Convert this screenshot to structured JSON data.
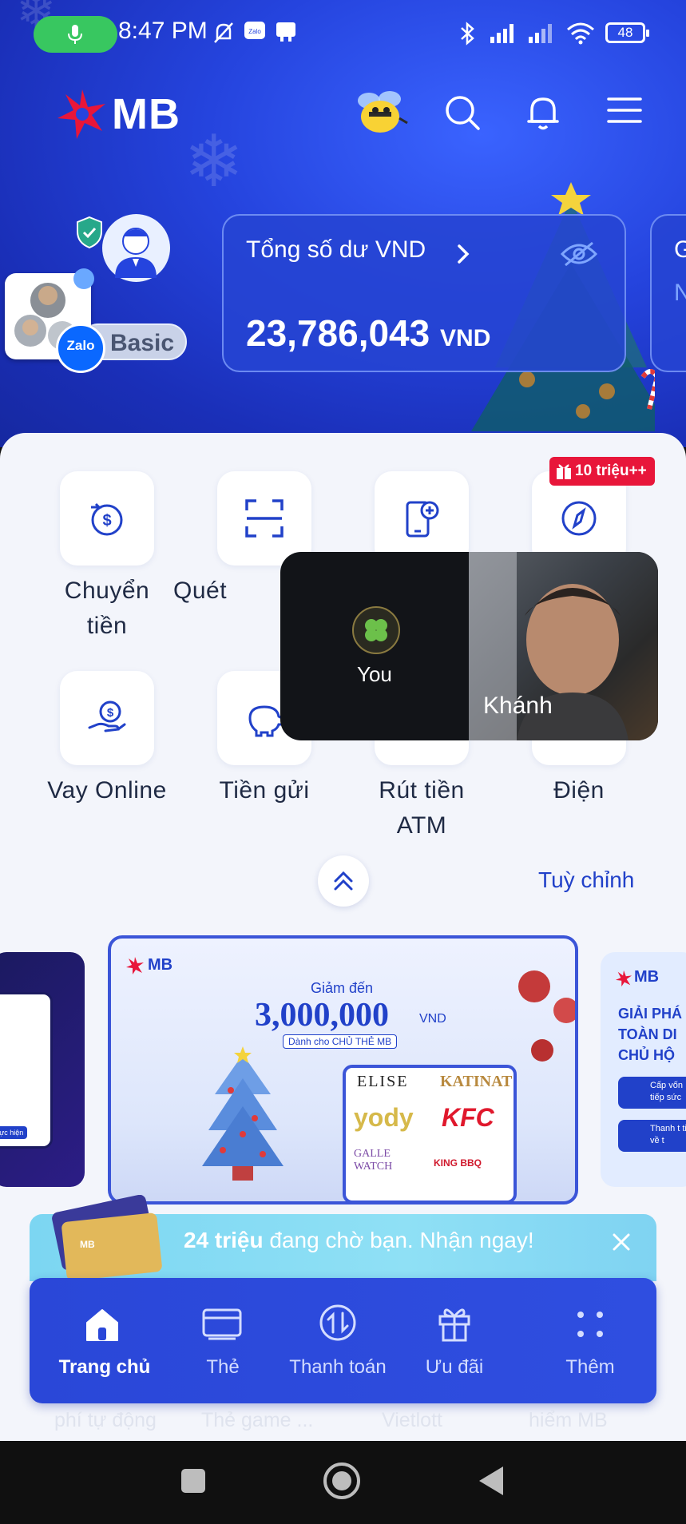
{
  "status_bar": {
    "time": "8:47 PM",
    "battery": "48",
    "icons": [
      "mic-icon",
      "mute-bell-icon",
      "zalo-icon",
      "chat-icon",
      "bluetooth-icon",
      "signal-icon",
      "signal-icon",
      "wifi-icon",
      "battery-icon"
    ]
  },
  "header": {
    "brand": "MB",
    "icons": [
      "bee-mascot",
      "search-icon",
      "bell-icon",
      "menu-icon"
    ]
  },
  "profile": {
    "tier": "Basic",
    "zalo_badge": "Zalo"
  },
  "balance_card": {
    "label": "Tổng số dư VND",
    "amount": "23,786,043",
    "currency": "VND",
    "next_card_initial": "G",
    "next_card_sub": "N"
  },
  "quick_actions": [
    {
      "label_line1": "Chuyển",
      "label_line2": "tiền",
      "icon": "transfer-icon"
    },
    {
      "label_line1": "Quét",
      "label_line2": "",
      "icon": "qr-scan-icon"
    },
    {
      "label_line1": "",
      "label_line2": "",
      "icon": "phone-topup-icon"
    },
    {
      "label_line1": "",
      "label_line2": "",
      "icon": "compass-icon",
      "badge": "10 triệu++"
    },
    {
      "label_line1": "Vay Online",
      "label_line2": "",
      "icon": "loan-hand-icon"
    },
    {
      "label_line1": "Tiền gửi",
      "label_line2": "",
      "icon": "piggy-bank-icon"
    },
    {
      "label_line1": "Rút tiền",
      "label_line2": "ATM",
      "icon": "atm-icon"
    },
    {
      "label_line1": "Điện",
      "label_line2": "",
      "icon": "electric-icon"
    }
  ],
  "call_overlay": {
    "self_label": "You",
    "remote_name": "Khánh"
  },
  "customize_label": "Tuỳ chỉnh",
  "banner": {
    "brand": "MB",
    "headline": "Giảm đến",
    "amount": "3,000,000",
    "currency": "VND",
    "sub": "Dành cho CHỦ THẺ MB",
    "merchants": [
      "ELISE",
      "KATINAT",
      "yody",
      "KFC",
      "GALLE WATCH",
      "KING BBQ"
    ],
    "left_banner_button": "Thực hiện",
    "right_banner_title": "GIẢI PHÁ TOÀN DI CHỦ HỘ",
    "right_banner_lines": [
      "Cấp vốn tiếp sức",
      "Thanh t tiền về t"
    ]
  },
  "promo_bar": {
    "amount": "24 triệu",
    "text": " đang chờ bạn. Nhận ngay!"
  },
  "tab_bar": [
    {
      "label": "Trang chủ",
      "icon": "home-icon",
      "active": true
    },
    {
      "label": "Thẻ",
      "icon": "card-icon",
      "active": false
    },
    {
      "label": "Thanh toán",
      "icon": "payment-icon",
      "active": false
    },
    {
      "label": "Ưu đãi",
      "icon": "gift-icon",
      "active": false
    },
    {
      "label": "Thêm",
      "icon": "more-icon",
      "active": false
    }
  ],
  "ghost_labels": [
    "phí tự động",
    "Thẻ game ...",
    "Vietlott",
    "hiểm MB"
  ],
  "colors": {
    "primary": "#2141c9",
    "hero_bg": "#2544de",
    "promo_red": "#e8163a",
    "call_green": "#38c760"
  }
}
